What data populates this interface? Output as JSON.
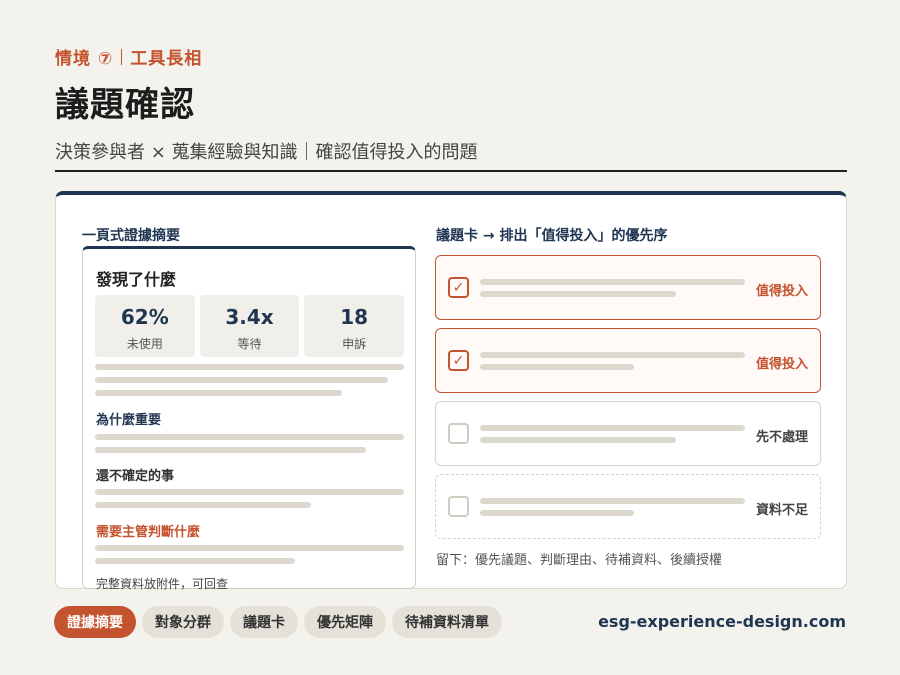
{
  "header": {
    "kicker_scenario": "情境 ⑦",
    "kicker_tool": "工具長相",
    "title": "議題確認",
    "subtitle": "決策參與者 × 蒐集經驗與知識｜確認值得投入的問題"
  },
  "left_panel": {
    "title": "一頁式證據摘要",
    "heading": "發現了什麼",
    "stats": [
      {
        "value": "62%",
        "label": "未使用"
      },
      {
        "value": "3.4x",
        "label": "等待"
      },
      {
        "value": "18",
        "label": "申訴"
      }
    ],
    "why_heading": "為什麼重要",
    "uncertain_heading": "還不確定的事",
    "decision_heading": "需要主管判斷什麼",
    "footnote": "完整資料放附件，可回查"
  },
  "right_panel": {
    "title": "議題卡 → 排出「值得投入」的優先序",
    "cards": [
      {
        "checked": true,
        "tag": "值得投入"
      },
      {
        "checked": true,
        "tag": "值得投入"
      },
      {
        "checked": false,
        "tag": "先不處理"
      },
      {
        "checked": false,
        "tag": "資料不足"
      }
    ],
    "check_glyph": "✓",
    "keep_note": "留下：優先議題、判斷理由、待補資料、後續授權"
  },
  "tabs": [
    {
      "label": "證據摘要",
      "active": true
    },
    {
      "label": "對象分群",
      "active": false
    },
    {
      "label": "議題卡",
      "active": false
    },
    {
      "label": "優先矩陣",
      "active": false
    },
    {
      "label": "待補資料清單",
      "active": false
    }
  ],
  "site": "esg-experience-design.com",
  "colors": {
    "accent": "#c4532f",
    "navy": "#1f3552",
    "background": "#f4f2ec",
    "placeholder": "#dcd8ce"
  }
}
